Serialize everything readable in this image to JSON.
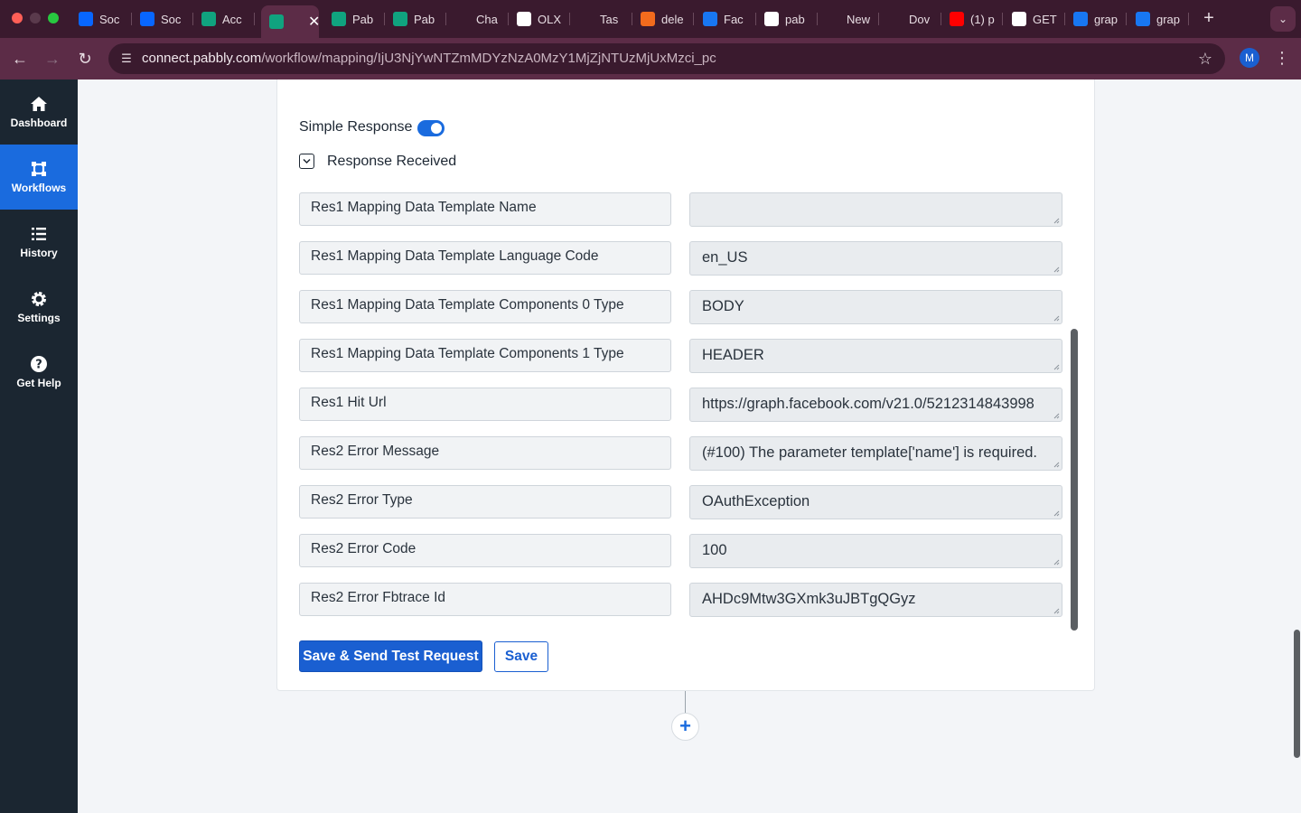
{
  "browser": {
    "tabs": [
      {
        "title": "Soc",
        "icon": "meta-icon",
        "color": "#0866ff"
      },
      {
        "title": "Soc",
        "icon": "meta-icon",
        "color": "#0866ff"
      },
      {
        "title": "Acc",
        "icon": "pabbly-icon",
        "color": "#10a37f"
      },
      {
        "title": "",
        "icon": "pabbly-icon",
        "color": "#10a37f",
        "active": true
      },
      {
        "title": "Pab",
        "icon": "pabbly-icon",
        "color": "#10a37f"
      },
      {
        "title": "Pab",
        "icon": "pabbly-icon",
        "color": "#10a37f"
      },
      {
        "title": "Cha",
        "icon": "openai-icon",
        "color": "#3a1a2e"
      },
      {
        "title": "OLX",
        "icon": "olx-icon",
        "color": "#ffffff"
      },
      {
        "title": "Tas",
        "icon": "task-icon",
        "color": "#3a1a2e"
      },
      {
        "title": "dele",
        "icon": "delete-icon",
        "color": "#f26b1d"
      },
      {
        "title": "Fac",
        "icon": "facebook-icon",
        "color": "#1877f2"
      },
      {
        "title": "pab",
        "icon": "google-icon",
        "color": "#ffffff"
      },
      {
        "title": "New",
        "icon": "chrome-icon",
        "color": "#3a1a2e"
      },
      {
        "title": "Dov",
        "icon": "download-icon",
        "color": "#3a1a2e"
      },
      {
        "title": "(1) p",
        "icon": "youtube-icon",
        "color": "#ff0000"
      },
      {
        "title": "GET",
        "icon": "google-icon",
        "color": "#ffffff"
      },
      {
        "title": "grap",
        "icon": "facebook-icon",
        "color": "#1877f2"
      },
      {
        "title": "grap",
        "icon": "facebook-icon",
        "color": "#1877f2"
      }
    ],
    "url_host": "connect.pabbly.com",
    "url_path": "/workflow/mapping/IjU3NjYwNTZmMDYzNzA0MzY1MjZjNTUzMjUxMzci_pc",
    "profile_initial": "M"
  },
  "sidebar": {
    "items": [
      {
        "label": "Dashboard",
        "icon": "home-icon"
      },
      {
        "label": "Workflows",
        "icon": "workflow-icon",
        "active": true
      },
      {
        "label": "History",
        "icon": "history-list-icon"
      },
      {
        "label": "Settings",
        "icon": "gear-icon"
      },
      {
        "label": "Get Help",
        "icon": "help-icon"
      }
    ]
  },
  "panel": {
    "simple_response_label": "Simple Response",
    "simple_response_on": true,
    "response_received_label": "Response Received",
    "rows": [
      {
        "key": "Res1 Mapping Data Template Name",
        "value": ""
      },
      {
        "key": "Res1 Mapping Data Template Language Code",
        "value": "en_US"
      },
      {
        "key": "Res1 Mapping Data Template Components 0 Type",
        "value": "BODY"
      },
      {
        "key": "Res1 Mapping Data Template Components 1 Type",
        "value": "HEADER"
      },
      {
        "key": "Res1 Hit Url",
        "value": "https://graph.facebook.com/v21.0/5212314843998"
      },
      {
        "key": "Res2 Error Message",
        "value": "(#100) The parameter template['name'] is required."
      },
      {
        "key": "Res2 Error Type",
        "value": "OAuthException"
      },
      {
        "key": "Res2 Error Code",
        "value": "100"
      },
      {
        "key": "Res2 Error Fbtrace Id",
        "value": "AHDc9Mtw3GXmk3uJBTgQGyz"
      }
    ],
    "save_send_label": "Save & Send Test Request",
    "save_label": "Save"
  },
  "colors": {
    "accent": "#1a6bde",
    "sidebar_bg": "#1b2631",
    "chrome_frame": "#3a1a2e"
  }
}
